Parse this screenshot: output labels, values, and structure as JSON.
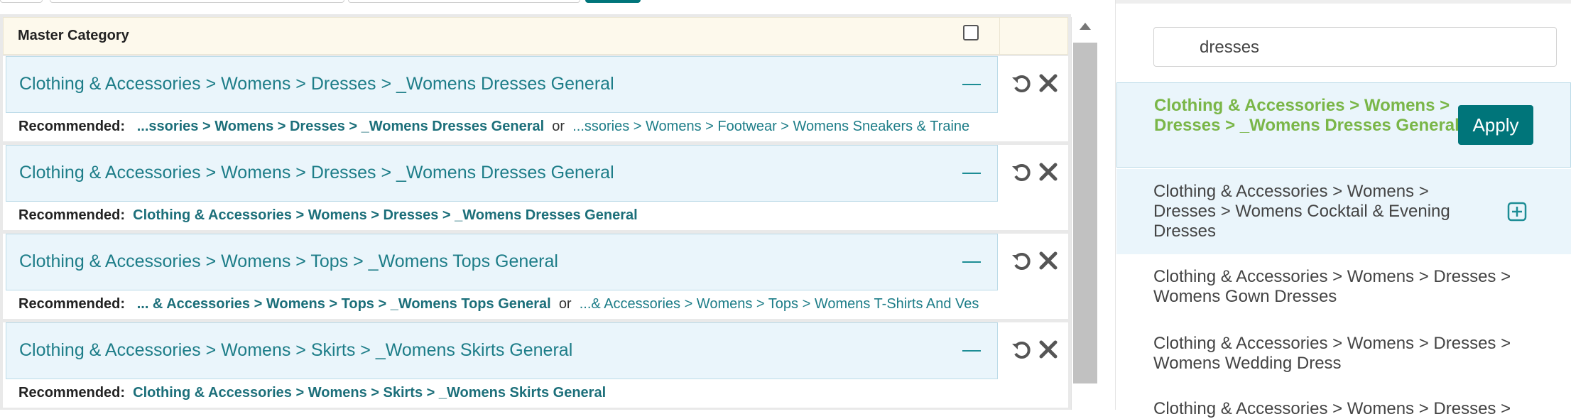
{
  "master_header": {
    "title": "Master Category"
  },
  "rows": [
    {
      "category": "Clothing & Accessories > Womens > Dresses > _Womens Dresses General",
      "recommended_label": "Recommended:",
      "rec1": "...ssories > Womens > Dresses > _Womens Dresses General",
      "or": "or",
      "rec2": "...ssories > Womens > Footwear > Womens Sneakers & Traine"
    },
    {
      "category": "Clothing & Accessories > Womens > Dresses > _Womens Dresses General",
      "recommended_label": "Recommended:",
      "rec1": "Clothing & Accessories > Womens > Dresses > _Womens Dresses General"
    },
    {
      "category": "Clothing & Accessories > Womens > Tops > _Womens Tops General",
      "recommended_label": "Recommended:",
      "rec1": "... & Accessories > Womens > Tops > _Womens Tops General",
      "or": "or",
      "rec2": "...& Accessories > Womens > Tops > Womens T-Shirts And Ves"
    },
    {
      "category": "Clothing & Accessories > Womens > Skirts > _Womens Skirts General",
      "recommended_label": "Recommended:",
      "rec1": "Clothing & Accessories > Womens > Skirts > _Womens Skirts General"
    }
  ],
  "search": {
    "value": "dresses"
  },
  "results": [
    {
      "label": "Clothing & Accessories > Womens > Dresses > _Womens Dresses General",
      "selected": true
    },
    {
      "label": "Clothing & Accessories > Womens > Dresses > Womens Cocktail & Evening Dresses"
    },
    {
      "label": "Clothing & Accessories > Womens > Dresses > Womens Gown Dresses"
    },
    {
      "label": "Clothing & Accessories > Womens > Dresses > Womens Wedding Dress"
    },
    {
      "label": "Clothing & Accessories > Womens > Dresses >"
    }
  ],
  "apply_label": "Apply",
  "icons": {
    "remove": "minus-icon",
    "undo": "undo-icon",
    "delete": "close-icon",
    "add": "plus-square-icon"
  },
  "colors": {
    "teal": "#00757a",
    "link": "#1d7d88",
    "selected": "#7ab648"
  }
}
